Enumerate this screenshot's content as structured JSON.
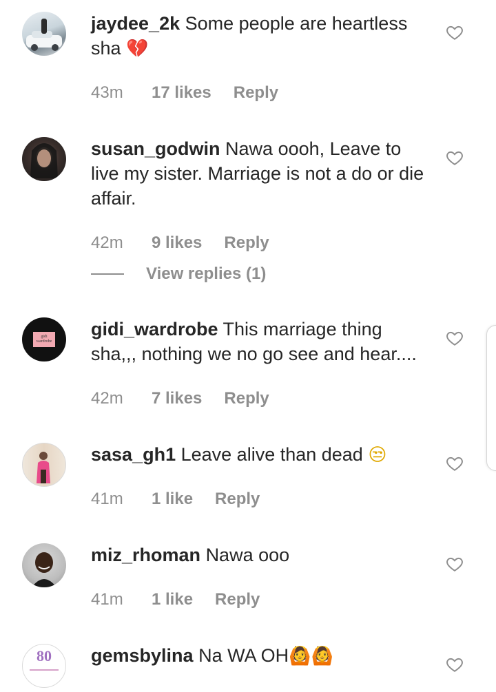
{
  "comments": [
    {
      "username": "jaydee_2k",
      "text": "Some people are heartless sha",
      "emoji": "💔",
      "time": "43m",
      "likes": "17 likes",
      "reply": "Reply",
      "avatar": "car-photo-avatar"
    },
    {
      "username": "susan_godwin",
      "text": "Nawa oooh, Leave to live my sister. Marriage is not a do or die affair.",
      "time": "42m",
      "likes": "9 likes",
      "reply": "Reply",
      "view_replies": "View replies (1)",
      "avatar": "woman-portrait-avatar"
    },
    {
      "username": "gidi_wardrobe",
      "text": "This marriage thing sha,,, nothing we no go see and hear....",
      "time": "42m",
      "likes": "7 likes",
      "reply": "Reply",
      "avatar": "brand-logo-avatar",
      "avatar_text": "gidi wardrobe"
    },
    {
      "username": "sasa_gh1",
      "text": "Leave alive than dead",
      "emoji": "😒",
      "time": "41m",
      "likes": "1 like",
      "reply": "Reply",
      "avatar": "mirror-selfie-avatar"
    },
    {
      "username": "miz_rhoman",
      "text": "Nawa ooo",
      "time": "41m",
      "likes": "1 like",
      "reply": "Reply",
      "avatar": "woman-smiling-avatar"
    },
    {
      "username": "gemsbylina",
      "text": "Na WA OH",
      "emoji": "🙆🙆",
      "avatar": "gems-logo-avatar",
      "avatar_text": "80"
    }
  ],
  "colors": {
    "text": "#262626",
    "meta": "#8e8e8e",
    "background": "#ffffff"
  }
}
